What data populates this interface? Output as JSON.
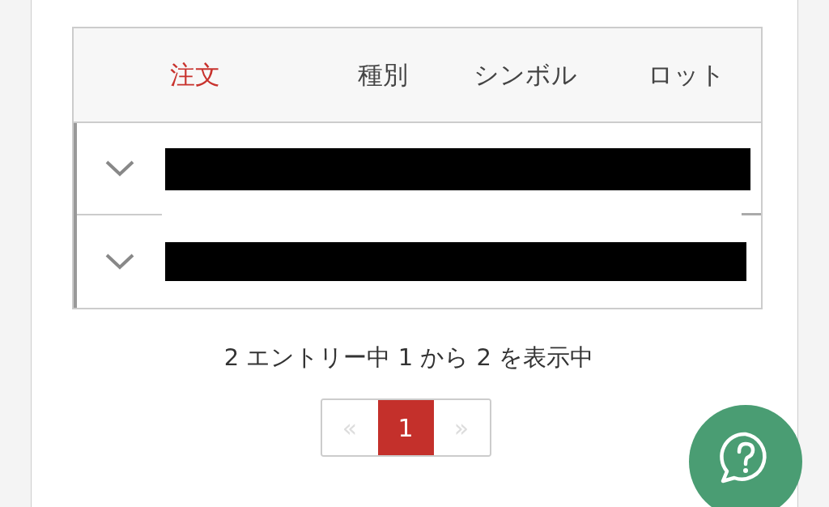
{
  "table": {
    "columns": [
      {
        "label": "注文",
        "sorted": true
      },
      {
        "label": "種別",
        "sorted": false
      },
      {
        "label": "シンボル",
        "sorted": false
      },
      {
        "label": "ロット",
        "sorted": false
      }
    ],
    "rows": [
      {
        "expanded": false
      },
      {
        "expanded": false
      }
    ]
  },
  "info": "2 エントリー中 1 から 2 を表示中",
  "pagination": {
    "prev": {
      "label": "«",
      "disabled": true
    },
    "pages": [
      {
        "label": "1",
        "selected": true
      }
    ],
    "next": {
      "label": "»",
      "disabled": true
    }
  }
}
